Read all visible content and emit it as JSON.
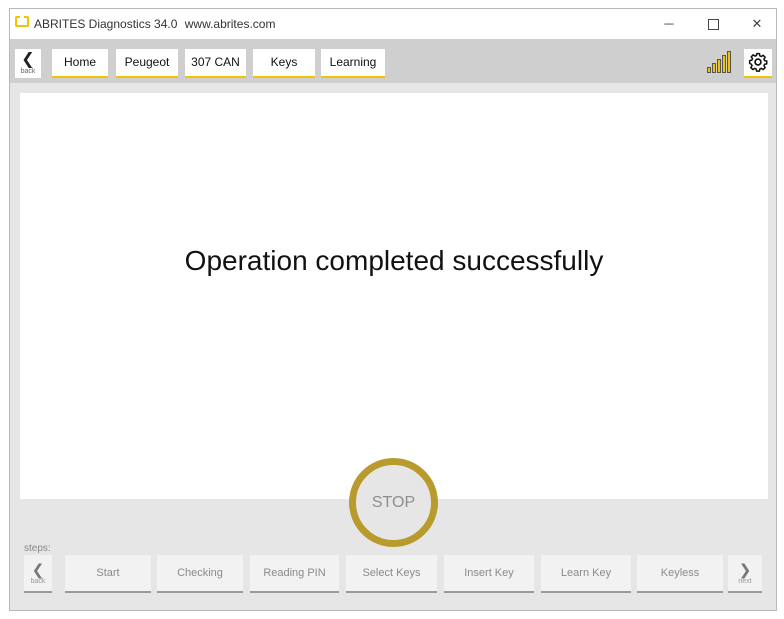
{
  "window": {
    "title": "ABRITES Diagnostics 34.0",
    "url": "www.abrites.com",
    "min_symbol": "─",
    "close_symbol": "✕"
  },
  "nav": {
    "back_symbol": "❮",
    "back_label": "back",
    "breadcrumbs": [
      "Home",
      "Peugeot",
      "307 CAN",
      "Keys",
      "Learning"
    ],
    "signal_icon": "signal-strength-icon",
    "settings_icon": "gear-icon",
    "accent": "#f2c300"
  },
  "main": {
    "message": "Operation completed successfully",
    "stop_label": "STOP",
    "stop_color": "#b99a2d"
  },
  "steps": {
    "label": "steps:",
    "back_symbol": "❮",
    "back_label": "back",
    "next_symbol": "❯",
    "next_label": "next",
    "items": [
      "Start",
      "Checking",
      "Reading PIN",
      "Select Keys",
      "Insert Key",
      "Learn Key",
      "Keyless"
    ]
  }
}
